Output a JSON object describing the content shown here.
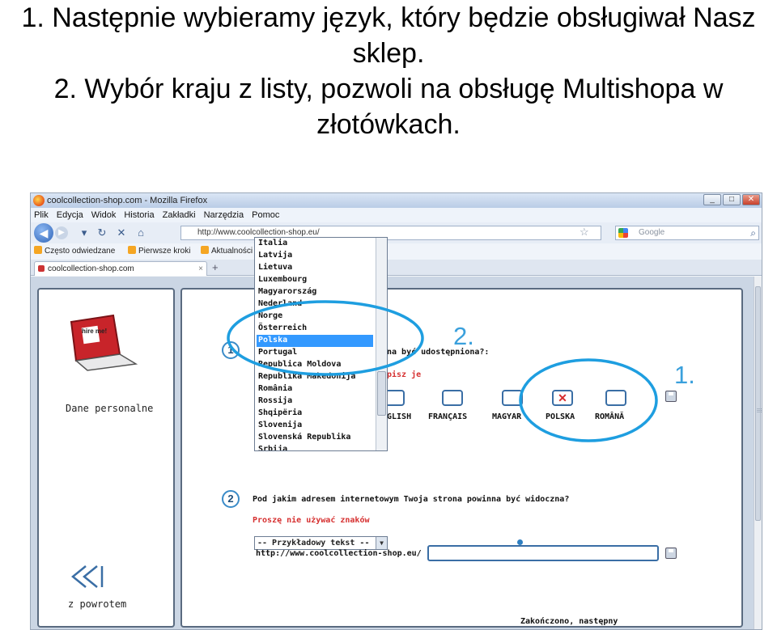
{
  "slide": {
    "line1": "1. Następnie wybieramy język, który będzie obsługiwał Nasz",
    "line2": "sklep.",
    "line3": "2. Wybór kraju z listy, pozwoli na obsługę Multishopa w",
    "line4": "złotówkach."
  },
  "browser": {
    "window_title": "coolcollection-shop.com - Mozilla Firefox",
    "window_buttons": [
      "_",
      "□",
      "✕"
    ],
    "menu": [
      "Plik",
      "Edycja",
      "Widok",
      "Historia",
      "Zakładki",
      "Narzędzia",
      "Pomoc"
    ],
    "url": "http://www.coolcollection-shop.eu/",
    "search_placeholder": "Google",
    "bookmarks": [
      "Często odwiedzane",
      "Pierwsze kroki",
      "Aktualności"
    ],
    "tab_title": "coolcollection-shop.com",
    "tab_close": "×",
    "tab_new": "+"
  },
  "sidebar": {
    "dane_label": "Dane personalne",
    "back_label": "z powrotem",
    "laptop_sticker": "hire me!"
  },
  "page": {
    "step1_number": "1",
    "step1_question_tail": "na być udostępniona?:",
    "step1_hint_tail": "pisz je",
    "languages": [
      "GLISH",
      "FRANÇAIS",
      "MAGYAR",
      "POLSKA",
      "ROMÂNĂ"
    ],
    "selected_language_mark": "✕",
    "country_select_value": "-- Przykładowy tekst --",
    "country_list": [
      "Italia",
      "Latvija",
      "Lietuva",
      "Luxembourg",
      "Magyarország",
      "Nederland",
      "Norge",
      "Österreich",
      "Polska",
      "Portugal",
      "Republica Moldova",
      "Republika Makedonija",
      "România",
      "Rossija",
      "Shqipëria",
      "Slovenija",
      "Slovenská Republika",
      "Srbija"
    ],
    "country_selected_index": 8,
    "step2_number": "2",
    "step2_question": "Pod jakim adresem internetowym Twoja strona powinna być widoczna?",
    "step2_hint": "Proszę nie używać znaków",
    "url_prefix": "http://www.coolcollection-shop.eu/",
    "url_value": "",
    "finish_link": "Zakończono, następny"
  },
  "annotations": {
    "marker_1": "1.",
    "marker_2": "2.",
    "circle_color": "#1e9ee0"
  },
  "colors": {
    "selection_blue": "#3399ff",
    "hint_red": "#d63030",
    "annotation_blue": "#3aa0dc"
  }
}
